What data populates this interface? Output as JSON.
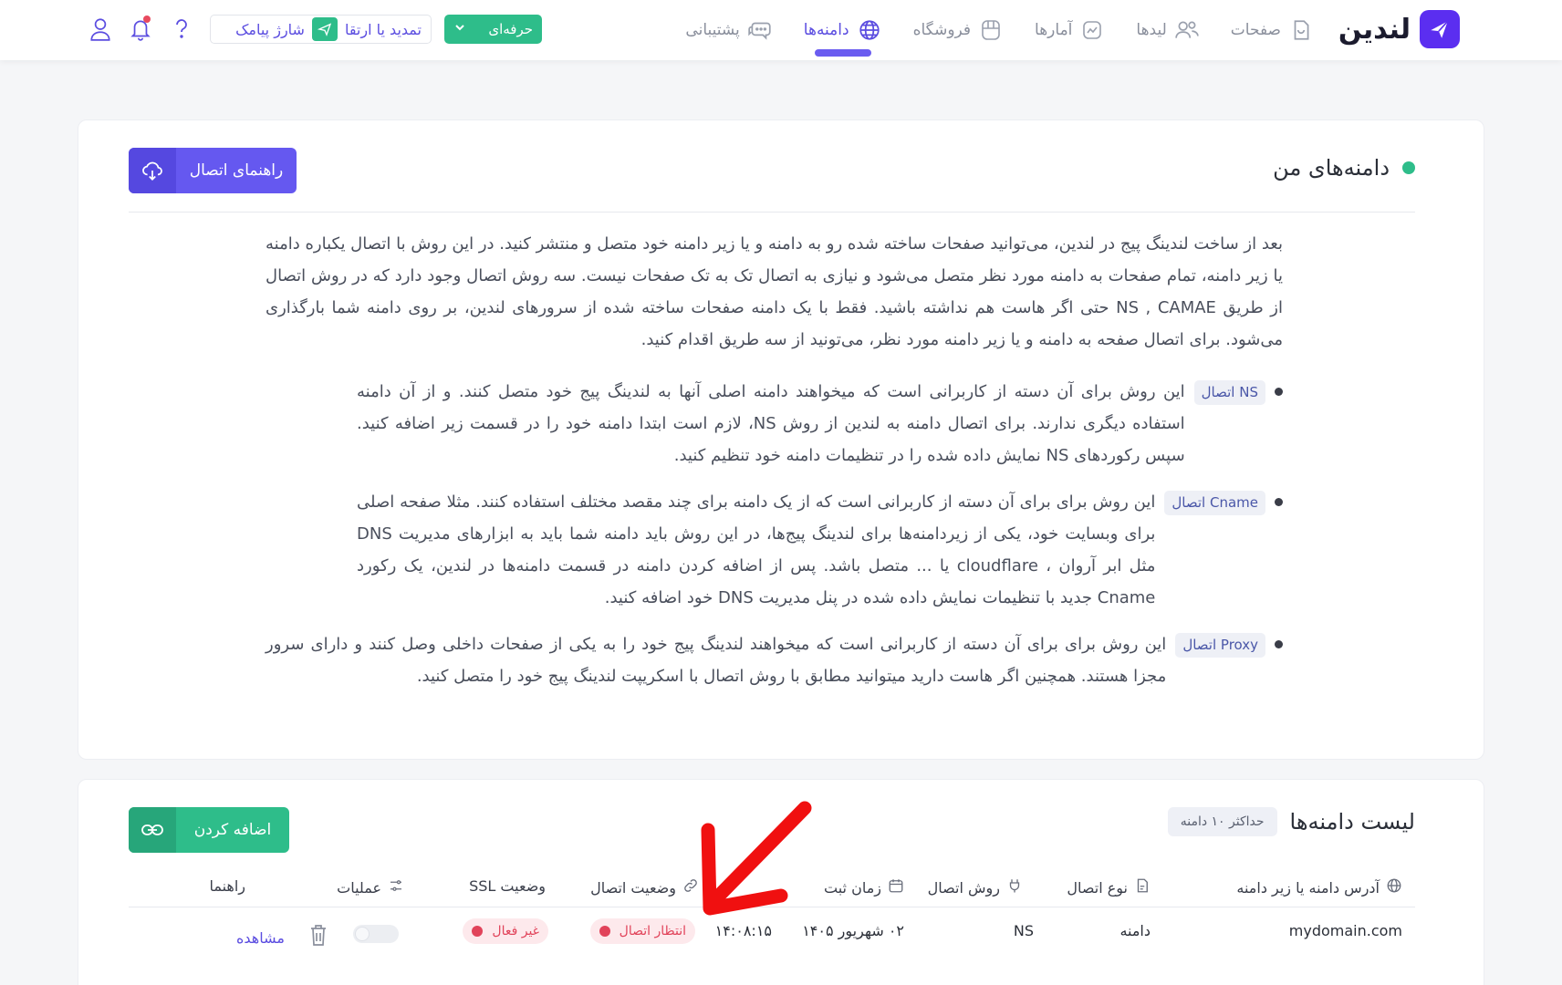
{
  "brand": {
    "name": "لندین"
  },
  "nav": [
    {
      "label": "صفحات",
      "icon": "pages-icon",
      "active": false
    },
    {
      "label": "لیدها",
      "icon": "users-icon",
      "active": false
    },
    {
      "label": "آمارها",
      "icon": "chart-icon",
      "active": false
    },
    {
      "label": "فروشگاه",
      "icon": "shop-icon",
      "active": false
    },
    {
      "label": "دامنه‌ها",
      "icon": "globe-icon",
      "active": true
    },
    {
      "label": "پشتیبانی",
      "icon": "chat-icon",
      "active": false
    }
  ],
  "topbar": {
    "plan_label": "حرفه‌ای",
    "renew_label": "تمدید یا ارتقا",
    "sms_label": "شارژ پیامک"
  },
  "domains_card": {
    "title": "دامنه‌های من",
    "guide_button": "راهنمای اتصال",
    "intro": "بعد از ساخت لندینگ پیج در لندین، می‌توانید صفحات ساخته شده رو به دامنه و یا زیر دامنه خود متصل و منتشر کنید. در این روش با اتصال یکباره دامنه یا زیر دامنه، تمام صفحات به دامنه مورد نظر متصل می‌شود و نیازی به اتصال تک به تک صفحات نیست. سه روش اتصال وجود دارد که در روش اتصال از طریق NS , CAMAE حتی اگر هاست هم نداشته باشید. فقط با یک دامنه صفحات ساخته شده از سرورهای لندین، بر روی دامنه شما بارگذاری می‌شود. برای اتصال صفحه به دامنه و یا زیر دامنه مورد نظر، می‌تونید از سه طریق اقدام کنید.",
    "methods": [
      {
        "tag": "اتصال NS",
        "text": "این روش برای آن دسته از کاربرانی است که میخواهند دامنه اصلی آنها به لندینگ پیج خود متصل کنند. و از آن دامنه استفاده دیگری ندارند. برای اتصال دامنه به لندین از روش NS، لازم است ابتدا دامنه خود را در قسمت زیر اضافه کنید. سپس رکوردهای NS نمایش داده شده را در تنظیمات دامنه خود تنظیم کنید."
      },
      {
        "tag": "اتصال Cname",
        "text": "این روش برای برای آن دسته از کاربرانی است که از یک دامنه برای چند مقصد مختلف استفاده کنند. مثلا صفحه اصلی برای وبسایت خود، یکی از زیردامنه‌ها برای لندینگ پیج‌ها، در این روش باید دامنه شما باید به ابزارهای مدیریت DNS مثل ابر آروان ، cloudflare یا ... متصل باشد. پس از اضافه کردن دامنه در قسمت دامنه‌ها در لندین، یک رکورد Cname جدید با تنظیمات نمایش داده شده در پنل مدیریت DNS خود اضافه کنید."
      },
      {
        "tag": "اتصال Proxy",
        "text": "این روش برای برای آن دسته از کاربرانی است که میخواهند لندینگ پیج خود را به یکی از صفحات داخلی وصل کنند و دارای سرور مجزا هستند. همچنین اگر هاست دارید میتوانید مطابق با روش اتصال با اسکریپت لندینگ پیج خود را متصل کنید."
      }
    ]
  },
  "list_card": {
    "title": "لیست دامنه‌ها",
    "max_badge": "حداکثر ۱۰ دامنه",
    "add_button": "اضافه کردن",
    "columns": {
      "address": "آدرس دامنه یا زیر دامنه",
      "type": "نوع اتصال",
      "method": "روش اتصال",
      "time": "زمان ثبت",
      "status": "وضعیت اتصال",
      "ssl": "وضعیت SSL",
      "ops": "عملیات",
      "guide": "راهنما"
    },
    "rows": [
      {
        "address": "mydomain.com",
        "type": "دامنه",
        "method": "NS",
        "date": "۰۲ شهریور ۱۴۰۵",
        "time": "۱۴:۰۸:۱۵",
        "status": "انتظار اتصال",
        "ssl": "غیر فعال",
        "guide": "مشاهده"
      }
    ]
  },
  "colors": {
    "accent": "#5b4de0",
    "brand": "#5b2ef0",
    "green": "#2ebd8a",
    "danger": "#e1435a",
    "annotation": "#f01010"
  }
}
